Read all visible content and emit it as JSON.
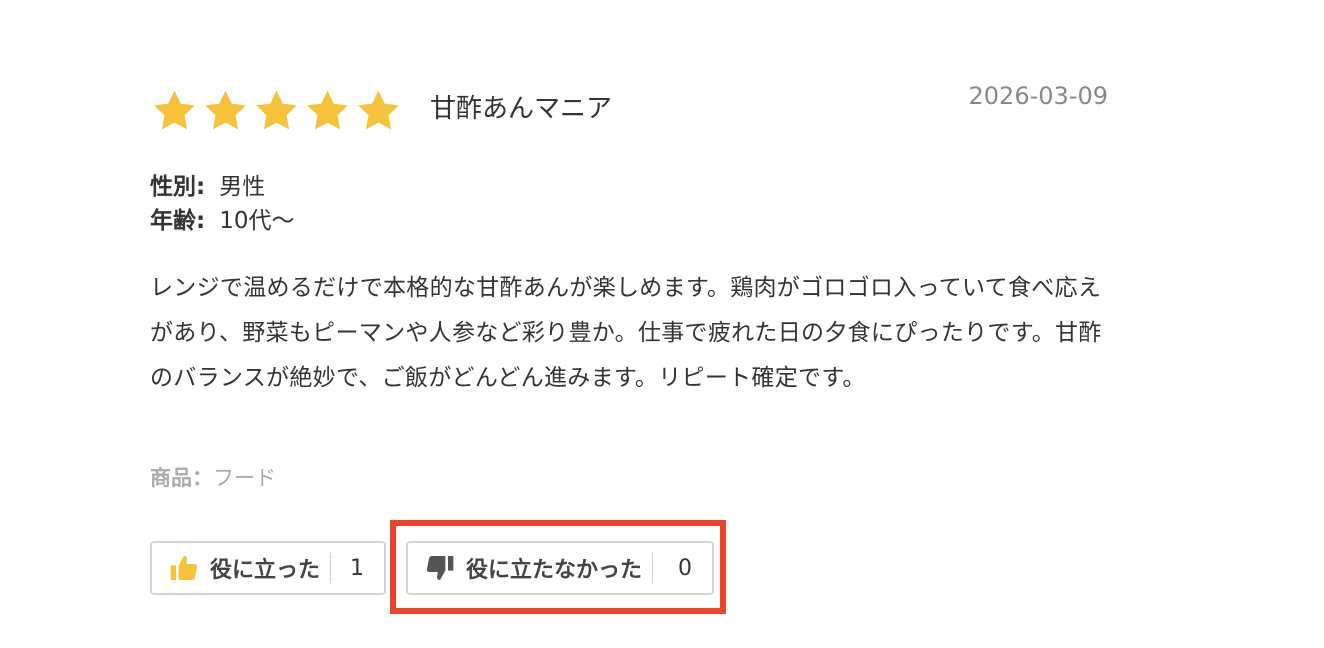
{
  "review": {
    "rating": 5,
    "rating_max": 5,
    "star_color": "#f5c23a",
    "reviewer": "甘酢あんマニア",
    "date": "2026-03-09",
    "meta": [
      {
        "key": "性別:",
        "value": "男性"
      },
      {
        "key": "年齢:",
        "value": "10代〜"
      }
    ],
    "body": "レンジで温めるだけで本格的な甘酢あんが楽しめます。鶏肉がゴロゴロ入っていて食べ応えがあり、野菜もピーマンや人参など彩り豊か。仕事で疲れた日の夕食にぴったりです。甘酢のバランスが絶妙で、ご飯がどんどん進みます。リピート確定です。",
    "category_key": "商品：",
    "category_value": "フード"
  },
  "votes": {
    "helpful": {
      "label": "役に立った",
      "count": "1",
      "icon": "thumbs-up-icon",
      "icon_color": "#f5c23a"
    },
    "not_helpful": {
      "label": "役に立たなかった",
      "count": "0",
      "icon": "thumbs-down-icon",
      "icon_color": "#555555"
    }
  },
  "highlight_color": "#e8452c"
}
